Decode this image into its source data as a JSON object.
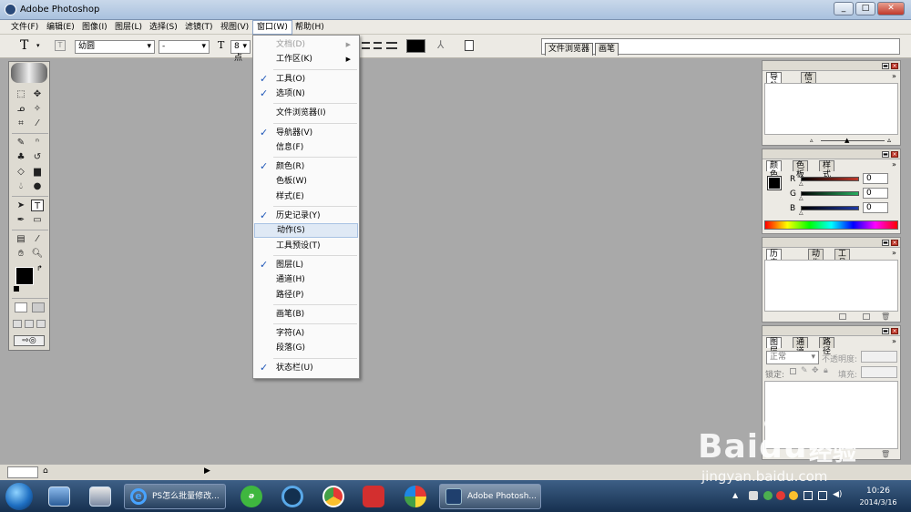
{
  "window": {
    "title": "Adobe Photoshop",
    "min": "_",
    "max": "□",
    "close": "✕"
  },
  "menubar": {
    "items": [
      "文件(F)",
      "编辑(E)",
      "图像(I)",
      "图层(L)",
      "选择(S)",
      "滤镜(T)",
      "视图(V)",
      "窗口(W)",
      "帮助(H)"
    ],
    "active": "窗口(W)"
  },
  "options": {
    "tool_glyph": "T",
    "font_family": "幼圆",
    "font_style": "-",
    "size_glyph": "T",
    "font_size": "8 点"
  },
  "palette_well": {
    "tabs": [
      "文件浏览器",
      "画笔"
    ]
  },
  "window_menu": {
    "items": [
      {
        "label": "文档(D)",
        "disabled": true,
        "submenu": true,
        "checked": false
      },
      {
        "label": "工作区(K)",
        "disabled": false,
        "submenu": true,
        "checked": false
      },
      {
        "sep": true
      },
      {
        "label": "工具(O)",
        "checked": true
      },
      {
        "label": "选项(N)",
        "checked": true
      },
      {
        "sep": true
      },
      {
        "label": "文件浏览器(I)",
        "checked": false
      },
      {
        "sep": true
      },
      {
        "label": "导航器(V)",
        "checked": true
      },
      {
        "label": "信息(F)",
        "checked": false
      },
      {
        "sep": true
      },
      {
        "label": "颜色(R)",
        "checked": true
      },
      {
        "label": "色板(W)",
        "checked": false
      },
      {
        "label": "样式(E)",
        "checked": false
      },
      {
        "sep": true
      },
      {
        "label": "历史记录(Y)",
        "checked": true
      },
      {
        "label": "动作(S)",
        "checked": false,
        "highlighted": true
      },
      {
        "label": "工具预设(T)",
        "checked": false
      },
      {
        "sep": true
      },
      {
        "label": "图层(L)",
        "checked": true
      },
      {
        "label": "通道(H)",
        "checked": false
      },
      {
        "label": "路径(P)",
        "checked": false
      },
      {
        "sep": true
      },
      {
        "label": "画笔(B)",
        "checked": false
      },
      {
        "sep": true
      },
      {
        "label": "字符(A)",
        "checked": false
      },
      {
        "label": "段落(G)",
        "checked": false
      },
      {
        "sep": true
      },
      {
        "label": "状态栏(U)",
        "checked": true
      }
    ]
  },
  "panels": {
    "navigator": {
      "tabs": [
        "导航器",
        "信息"
      ]
    },
    "color": {
      "tabs": [
        "颜色",
        "色板",
        "样式"
      ],
      "channels": [
        {
          "name": "R",
          "value": "0",
          "color": "#c0392b"
        },
        {
          "name": "G",
          "value": "0",
          "color": "#27ae60"
        },
        {
          "name": "B",
          "value": "0",
          "color": "#1f3aa6"
        }
      ]
    },
    "history": {
      "tabs": [
        "历史记录",
        "动作",
        "工具预设"
      ]
    },
    "layers": {
      "tabs": [
        "图层",
        "通道",
        "路径"
      ],
      "blend_mode": "正常",
      "opacity_label": "不透明度:",
      "lock_label": "锁定:",
      "fill_label": "填充:"
    }
  },
  "taskbar": {
    "buttons": [
      {
        "label": "PS怎么批量修改...",
        "icon": "ie-icon"
      },
      {
        "label": "Adobe Photosh...",
        "icon": "photoshop-icon"
      }
    ],
    "time": "10:26",
    "date": "2014/3/16"
  },
  "watermark": {
    "brand": "Baidu",
    "cn": "经验",
    "url": "jingyan.baidu.com"
  },
  "colors": {
    "check": "#1f57b8",
    "canvas": "#a9a9a9",
    "menu_highlight": "#dfe9f5"
  }
}
